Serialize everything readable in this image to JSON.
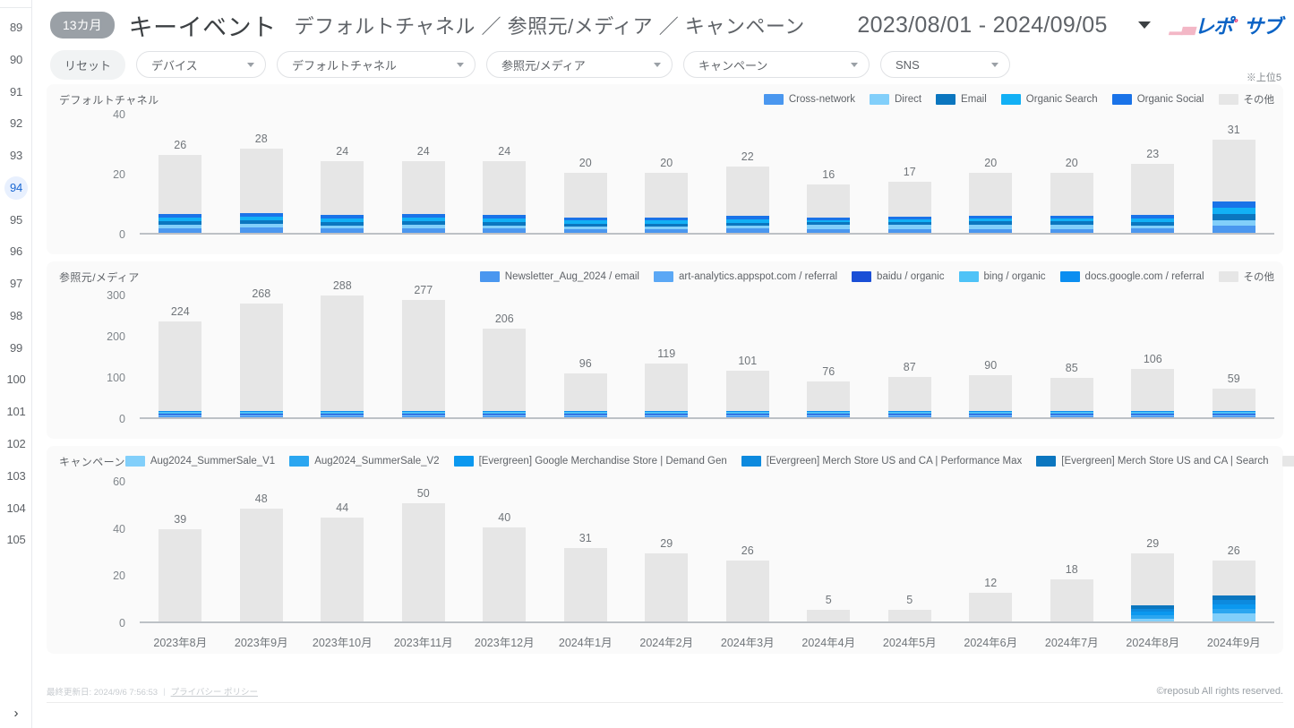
{
  "sidebar": {
    "pages": [
      "89",
      "90",
      "91",
      "92",
      "93",
      "94",
      "95",
      "96",
      "97",
      "98",
      "99",
      "100",
      "101",
      "102",
      "103",
      "104",
      "105"
    ],
    "active_page": "94",
    "expand_icon": "›"
  },
  "header": {
    "badge": "13カ月",
    "title": "キーイベント",
    "subtitle": "デフォルトチャネル ／ 参照元/メディア ／ キャンペーン",
    "date_range": "2023/08/01 - 2024/09/05",
    "logo_parts": {
      "p1": "▁▃",
      "p2": "レポ",
      "p3": "゜",
      "p4": "サブ"
    }
  },
  "filters": {
    "reset_label": "リセット",
    "items": [
      {
        "label": "デバイス"
      },
      {
        "label": "デフォルトチャネル"
      },
      {
        "label": "参照元/メディア"
      },
      {
        "label": "キャンペーン"
      },
      {
        "label": "SNS"
      }
    ],
    "note": "※上位5"
  },
  "footer": {
    "last_updated": "最終更新日: 2024/9/6 7:56:53",
    "separator": "|",
    "privacy_link": "プライバシー ポリシー",
    "copyright": "©reposub All rights reserved."
  },
  "colors": {
    "cross_network": "#4a97ef",
    "direct": "#82cffa",
    "email": "#0b76bf",
    "organic_search": "#12b0f5",
    "organic_social": "#1a73e8",
    "other": "#e6e6e6",
    "s1": "#4a97ef",
    "s2": "#5ba8f5",
    "s3": "#1a4fd6",
    "s4": "#4ec3f7",
    "s5": "#0b8ef0",
    "c1": "#82cffa",
    "c2": "#2ba6f0",
    "c3": "#0b98ef",
    "c4": "#0d8ade",
    "c5": "#0b76bf",
    "axis": "#bdc1c6",
    "text": "#70757a"
  },
  "chart_data": [
    {
      "type": "bar",
      "stacked": true,
      "title": "デフォルトチャネル",
      "xlabel": "",
      "ylabel": "",
      "ylim": [
        0,
        40
      ],
      "yticks": [
        "0",
        "20",
        "40"
      ],
      "ytick_values": [
        0,
        20,
        40
      ],
      "legend_position": "top-right",
      "grid": false,
      "categories": [
        "2023年8月",
        "2023年9月",
        "2023年10月",
        "2023年11月",
        "2023年12月",
        "2024年1月",
        "2024年2月",
        "2024年3月",
        "2024年4月",
        "2024年5月",
        "2024年6月",
        "2024年7月",
        "2024年8月",
        "2024年9月"
      ],
      "totals": [
        26,
        28,
        24,
        24,
        24,
        20,
        20,
        22,
        16,
        17,
        20,
        20,
        23,
        31
      ],
      "series": [
        {
          "name": "Cross-network",
          "color": "#4a97ef",
          "values": [
            1.6,
            1.7,
            1.5,
            1.6,
            1.5,
            1.3,
            1.3,
            1.4,
            1.1,
            1.2,
            1.3,
            1.3,
            1.5,
            2.3
          ]
        },
        {
          "name": "Direct",
          "color": "#82cffa",
          "values": [
            1.1,
            1.2,
            1.0,
            1.1,
            1.0,
            0.9,
            0.9,
            1.0,
            1.6,
            1.6,
            1.5,
            1.5,
            1.0,
            1.9
          ]
        },
        {
          "name": "Email",
          "color": "#0b76bf",
          "values": [
            1.1,
            1.2,
            1.1,
            1.1,
            1.1,
            0.9,
            0.9,
            1.0,
            0.8,
            0.9,
            1.0,
            1.0,
            1.1,
            2.0
          ]
        },
        {
          "name": "Organic Search",
          "color": "#12b0f5",
          "values": [
            1.2,
            1.3,
            1.1,
            1.2,
            1.1,
            1.0,
            1.0,
            1.1,
            0.8,
            0.9,
            1.0,
            1.0,
            1.2,
            2.1
          ]
        },
        {
          "name": "Organic Social",
          "color": "#1a73e8",
          "values": [
            1.2,
            1.3,
            1.2,
            1.2,
            1.2,
            1.0,
            1.0,
            1.1,
            0.8,
            0.9,
            1.0,
            1.0,
            1.2,
            2.1
          ]
        },
        {
          "name": "その他",
          "color": "#e6e6e6",
          "values": [
            19.8,
            21.3,
            18.1,
            17.8,
            18.1,
            14.9,
            14.9,
            16.4,
            10.9,
            11.5,
            14.2,
            14.2,
            17.0,
            20.6
          ]
        }
      ]
    },
    {
      "type": "bar",
      "stacked": true,
      "title": "参照元/メディア",
      "xlabel": "",
      "ylabel": "",
      "ylim": [
        0,
        300
      ],
      "yticks": [
        "0",
        "100",
        "200",
        "300"
      ],
      "ytick_values": [
        0,
        100,
        200,
        300
      ],
      "legend_position": "top-right",
      "grid": false,
      "categories": [
        "2023年8月",
        "2023年9月",
        "2023年10月",
        "2023年11月",
        "2023年12月",
        "2024年1月",
        "2024年2月",
        "2024年3月",
        "2024年4月",
        "2024年5月",
        "2024年6月",
        "2024年7月",
        "2024年8月",
        "2024年9月"
      ],
      "totals": [
        224,
        268,
        288,
        277,
        206,
        96,
        119,
        101,
        76,
        87,
        90,
        85,
        106,
        59
      ],
      "series": [
        {
          "name": "Newsletter_Aug_2024 / email",
          "color": "#4a97ef",
          "values": [
            1,
            1,
            1,
            1,
            1,
            1,
            1,
            1,
            1,
            1,
            1,
            1,
            1,
            1
          ]
        },
        {
          "name": "art-analytics.appspot.com / referral",
          "color": "#5ba8f5",
          "values": [
            2,
            2,
            2,
            2,
            2,
            1,
            1,
            1,
            1,
            1,
            1,
            1,
            1,
            1
          ]
        },
        {
          "name": "baidu / organic",
          "color": "#1a4fd6",
          "values": [
            1,
            1,
            1,
            1,
            1,
            1,
            1,
            1,
            1,
            1,
            1,
            1,
            1,
            1
          ]
        },
        {
          "name": "bing / organic",
          "color": "#4ec3f7",
          "values": [
            2,
            2,
            2,
            2,
            2,
            1,
            1,
            1,
            1,
            1,
            1,
            1,
            1,
            1
          ]
        },
        {
          "name": "docs.google.com / referral",
          "color": "#0b8ef0",
          "values": [
            2,
            2,
            2,
            2,
            2,
            1,
            1,
            1,
            1,
            1,
            1,
            1,
            1,
            1
          ]
        },
        {
          "name": "その他",
          "color": "#e6e6e6",
          "values": [
            216,
            260,
            280,
            269,
            198,
            91,
            114,
            96,
            71,
            82,
            85,
            80,
            101,
            54
          ]
        }
      ]
    },
    {
      "type": "bar",
      "stacked": true,
      "title": "キャンペーン",
      "xlabel": "",
      "ylabel": "",
      "ylim": [
        0,
        60
      ],
      "yticks": [
        "0",
        "20",
        "40",
        "60"
      ],
      "ytick_values": [
        0,
        20,
        40,
        60
      ],
      "legend_position": "top-right",
      "grid": false,
      "categories": [
        "2023年8月",
        "2023年9月",
        "2023年10月",
        "2023年11月",
        "2023年12月",
        "2024年1月",
        "2024年2月",
        "2024年3月",
        "2024年4月",
        "2024年5月",
        "2024年6月",
        "2024年7月",
        "2024年8月",
        "2024年9月"
      ],
      "totals": [
        39,
        48,
        44,
        50,
        40,
        31,
        29,
        26,
        5,
        5,
        12,
        18,
        29,
        26
      ],
      "series": [
        {
          "name": "Aug2024_SummerSale_V1",
          "color": "#82cffa",
          "values": [
            0,
            0,
            0,
            0,
            0,
            0,
            0,
            0,
            0,
            0,
            0,
            0,
            1.2,
            3.6
          ]
        },
        {
          "name": "Aug2024_SummerSale_V2",
          "color": "#2ba6f0",
          "values": [
            0,
            0,
            0,
            0,
            0,
            0,
            0,
            0,
            0,
            0,
            0,
            0,
            1.3,
            1.7
          ]
        },
        {
          "name": "[Evergreen] Google Merchandise Store | Demand Gen",
          "color": "#0b98ef",
          "values": [
            0,
            0,
            0,
            0,
            0,
            0,
            0,
            0,
            0,
            0,
            0,
            0,
            1.5,
            2.0
          ]
        },
        {
          "name": "[Evergreen] Merch Store US and CA | Performance Max",
          "color": "#0d8ade",
          "values": [
            0,
            0,
            0,
            0,
            0,
            0,
            0,
            0,
            0,
            0,
            0,
            0,
            1.4,
            1.8
          ]
        },
        {
          "name": "[Evergreen] Merch Store US and CA | Search",
          "color": "#0b76bf",
          "values": [
            0,
            0,
            0,
            0,
            0,
            0,
            0,
            0,
            0,
            0,
            0,
            0,
            1.4,
            1.9
          ]
        },
        {
          "name": "その他",
          "color": "#e6e6e6",
          "values": [
            39,
            48,
            44,
            50,
            40,
            31,
            29,
            26,
            5,
            5,
            12,
            18,
            22.2,
            15.0
          ]
        }
      ]
    }
  ]
}
